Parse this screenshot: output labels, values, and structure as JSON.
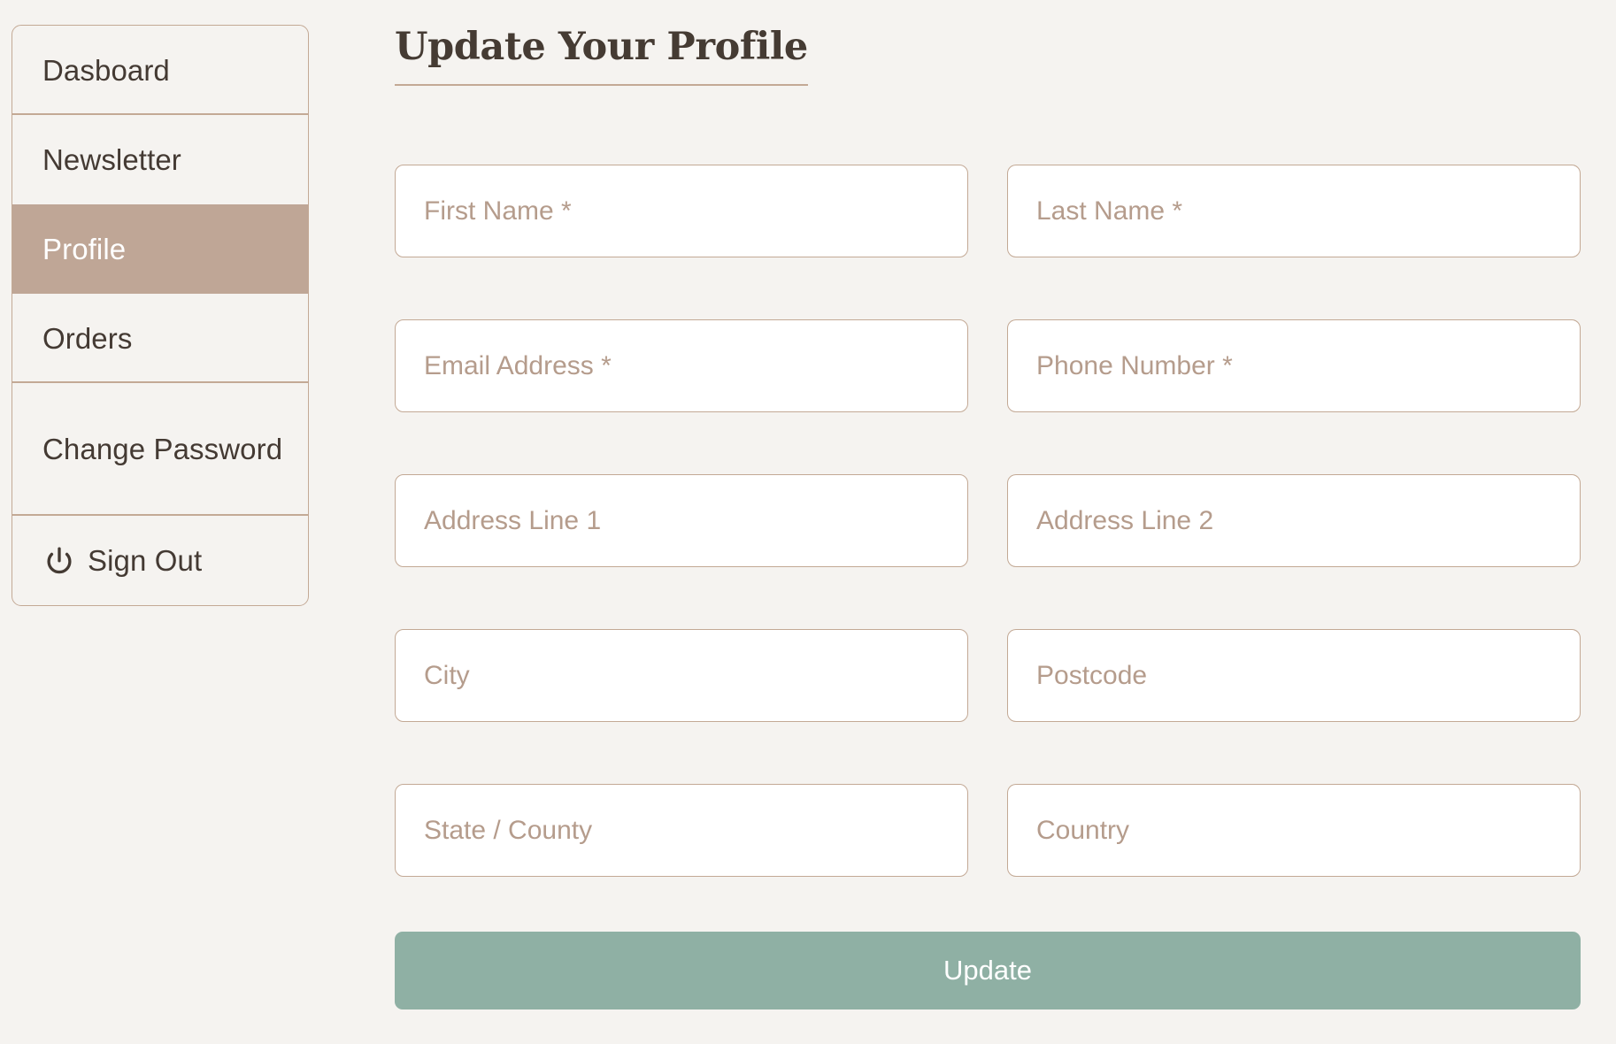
{
  "theme": {
    "page_background": "#F5F3F0",
    "accent_tan": "#C3A995",
    "active_item_background": "#BFA696",
    "text_dark": "#443A33",
    "placeholder_color": "#B59C8C",
    "button_green": "#8FB0A4",
    "field_background": "#FFFFFF"
  },
  "sidebar": {
    "items": [
      {
        "label": "Dasboard",
        "active": false,
        "icon": null
      },
      {
        "label": "Newsletter",
        "active": false,
        "icon": null
      },
      {
        "label": "Profile",
        "active": true,
        "icon": null
      },
      {
        "label": "Orders",
        "active": false,
        "icon": null
      },
      {
        "label": "Change Password",
        "active": false,
        "icon": null
      },
      {
        "label": "Sign Out",
        "active": false,
        "icon": "power-icon"
      }
    ]
  },
  "main": {
    "title": "Update Your Profile",
    "fields": [
      {
        "placeholder": "First Name *",
        "value": "",
        "name": "first-name"
      },
      {
        "placeholder": "Last Name *",
        "value": "",
        "name": "last-name"
      },
      {
        "placeholder": "Email Address *",
        "value": "",
        "name": "email-address"
      },
      {
        "placeholder": "Phone Number *",
        "value": "",
        "name": "phone-number"
      },
      {
        "placeholder": "Address Line 1",
        "value": "",
        "name": "address-line-1"
      },
      {
        "placeholder": "Address Line 2",
        "value": "",
        "name": "address-line-2"
      },
      {
        "placeholder": "City",
        "value": "",
        "name": "city"
      },
      {
        "placeholder": "Postcode",
        "value": "",
        "name": "postcode"
      },
      {
        "placeholder": "State / County",
        "value": "",
        "name": "state-county"
      },
      {
        "placeholder": "Country",
        "value": "",
        "name": "country"
      }
    ],
    "submit_label": "Update"
  }
}
